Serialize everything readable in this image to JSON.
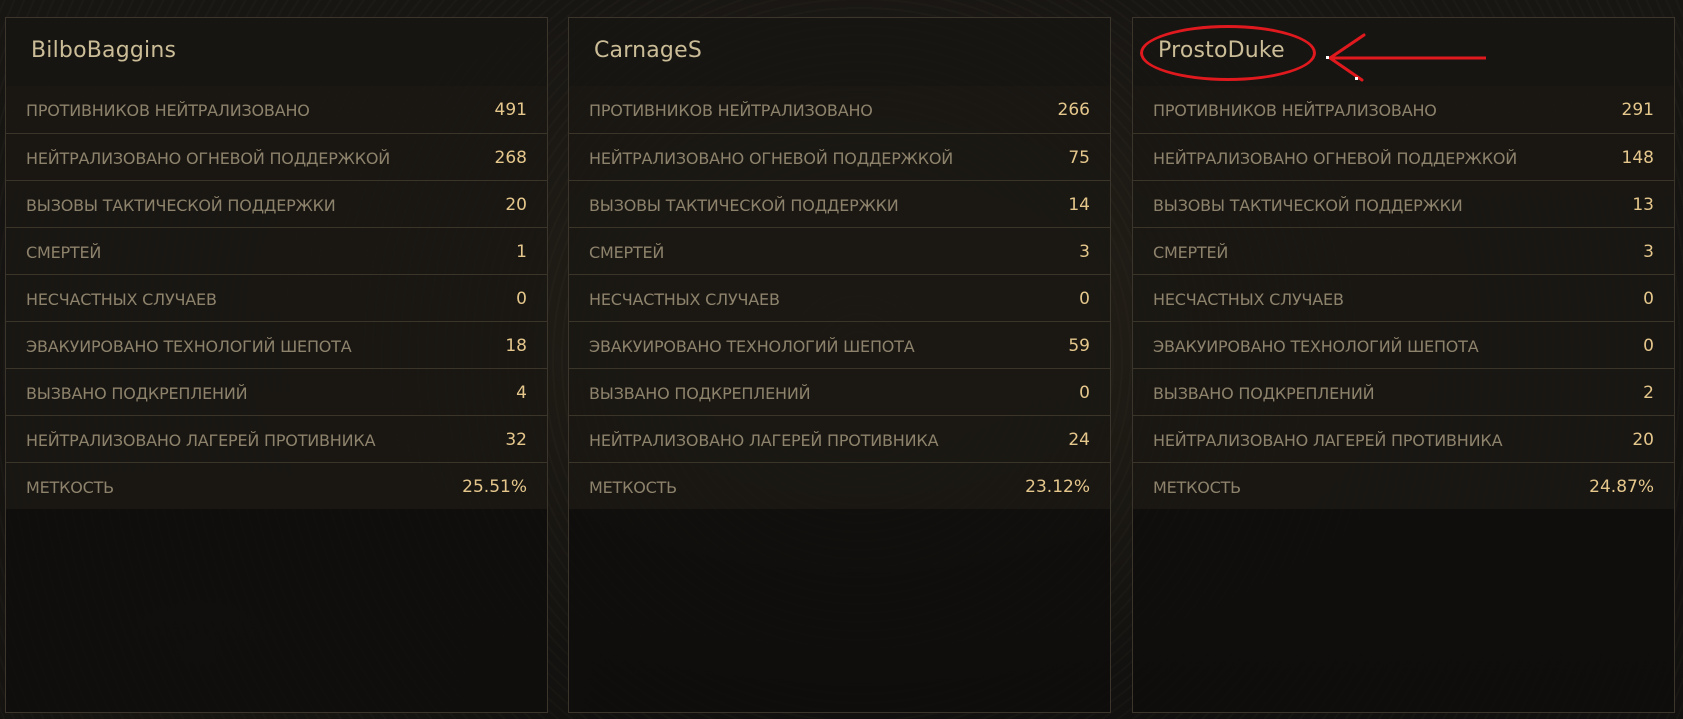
{
  "players": [
    {
      "name": "BilboBaggins",
      "stats": [
        {
          "label": "ПРОТИВНИКОВ НЕЙТРАЛИЗОВАНО",
          "value": "491"
        },
        {
          "label": "НЕЙТРАЛИЗОВАНО ОГНЕВОЙ ПОДДЕРЖКОЙ",
          "value": "268"
        },
        {
          "label": "ВЫЗОВЫ ТАКТИЧЕСКОЙ ПОДДЕРЖКИ",
          "value": "20"
        },
        {
          "label": "СМЕРТЕЙ",
          "value": "1"
        },
        {
          "label": "НЕСЧАСТНЫХ СЛУЧАЕВ",
          "value": "0"
        },
        {
          "label": "ЭВАКУИРОВАНО ТЕХНОЛОГИЙ ШЕПОТА",
          "value": "18"
        },
        {
          "label": "ВЫЗВАНО ПОДКРЕПЛЕНИЙ",
          "value": "4"
        },
        {
          "label": "НЕЙТРАЛИЗОВАНО ЛАГЕРЕЙ ПРОТИВНИКА",
          "value": "32"
        },
        {
          "label": "МЕТКОСТЬ",
          "value": "25.51%"
        }
      ]
    },
    {
      "name": "CarnageS",
      "stats": [
        {
          "label": "ПРОТИВНИКОВ НЕЙТРАЛИЗОВАНО",
          "value": "266"
        },
        {
          "label": "НЕЙТРАЛИЗОВАНО ОГНЕВОЙ ПОДДЕРЖКОЙ",
          "value": "75"
        },
        {
          "label": "ВЫЗОВЫ ТАКТИЧЕСКОЙ ПОДДЕРЖКИ",
          "value": "14"
        },
        {
          "label": "СМЕРТЕЙ",
          "value": "3"
        },
        {
          "label": "НЕСЧАСТНЫХ СЛУЧАЕВ",
          "value": "0"
        },
        {
          "label": "ЭВАКУИРОВАНО ТЕХНОЛОГИЙ ШЕПОТА",
          "value": "59"
        },
        {
          "label": "ВЫЗВАНО ПОДКРЕПЛЕНИЙ",
          "value": "0"
        },
        {
          "label": "НЕЙТРАЛИЗОВАНО ЛАГЕРЕЙ ПРОТИВНИКА",
          "value": "24"
        },
        {
          "label": "МЕТКОСТЬ",
          "value": "23.12%"
        }
      ]
    },
    {
      "name": "ProstoDuke",
      "stats": [
        {
          "label": "ПРОТИВНИКОВ НЕЙТРАЛИЗОВАНО",
          "value": "291"
        },
        {
          "label": "НЕЙТРАЛИЗОВАНО ОГНЕВОЙ ПОДДЕРЖКОЙ",
          "value": "148"
        },
        {
          "label": "ВЫЗОВЫ ТАКТИЧЕСКОЙ ПОДДЕРЖКИ",
          "value": "13"
        },
        {
          "label": "СМЕРТЕЙ",
          "value": "3"
        },
        {
          "label": "НЕСЧАСТНЫХ СЛУЧАЕВ",
          "value": "0"
        },
        {
          "label": "ЭВАКУИРОВАНО ТЕХНОЛОГИЙ ШЕПОТА",
          "value": "0"
        },
        {
          "label": "ВЫЗВАНО ПОДКРЕПЛЕНИЙ",
          "value": "2"
        },
        {
          "label": "НЕЙТРАЛИЗОВАНО ЛАГЕРЕЙ ПРОТИВНИКА",
          "value": "20"
        },
        {
          "label": "МЕТКОСТЬ",
          "value": "24.87%"
        }
      ]
    }
  ],
  "annotation": {
    "color": "#e0191e",
    "highlighted_player": "ProstoDuke"
  },
  "colors": {
    "name": "#cbbd97",
    "label": "#8d826b",
    "value": "#e5c78c",
    "border": "#3b352b"
  }
}
